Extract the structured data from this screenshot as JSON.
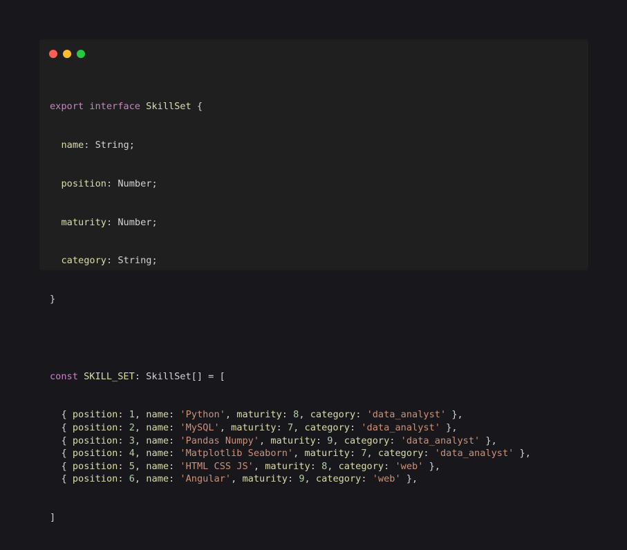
{
  "window": {
    "controls": [
      {
        "name": "close",
        "color": "#ff5f56"
      },
      {
        "name": "minimize",
        "color": "#ffbd2e"
      },
      {
        "name": "maximize",
        "color": "#27c93f"
      }
    ]
  },
  "code": {
    "interface": {
      "kw_export": "export",
      "kw_interface": "interface",
      "name": "SkillSet",
      "open": " {",
      "fields": [
        {
          "name": "name",
          "type": "String"
        },
        {
          "name": "position",
          "type": "Number"
        },
        {
          "name": "maturity",
          "type": "Number"
        },
        {
          "name": "category",
          "type": "String"
        }
      ],
      "close": "}"
    },
    "const_decl": {
      "kw_const": "const",
      "name": "SKILL_SET",
      "type": "SkillSet[]",
      "eq_open": " = [",
      "close": "]"
    },
    "keys": {
      "position": "position",
      "name": "name",
      "maturity": "maturity",
      "category": "category"
    },
    "skills": [
      {
        "position": "1",
        "name": "'Python'",
        "maturity": "8",
        "category": "'data_analyst'"
      },
      {
        "position": "2",
        "name": "'MySQL'",
        "maturity": "7",
        "category": "'data_analyst'"
      },
      {
        "position": "3",
        "name": "'Pandas Numpy'",
        "maturity": "9",
        "category": "'data_analyst'"
      },
      {
        "position": "4",
        "name": "'Matplotlib Seaborn'",
        "maturity": "7",
        "category": "'data_analyst'"
      },
      {
        "position": "5",
        "name": "'HTML CSS JS'",
        "maturity": "8",
        "category": "'web'"
      },
      {
        "position": "6",
        "name": "'Angular'",
        "maturity": "9",
        "category": "'web'"
      }
    ]
  }
}
